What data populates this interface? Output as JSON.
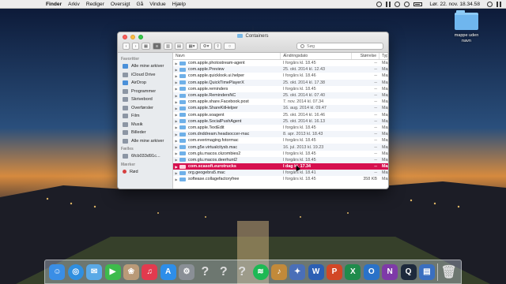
{
  "menubar": {
    "apple": "",
    "items": [
      "Finder",
      "Arkiv",
      "Rediger",
      "Oversigt",
      "Gå",
      "Vindue",
      "Hjælp"
    ],
    "clock": "Lør. 22. nov. 18.34.58"
  },
  "desktop_folder": {
    "label_line1": "mappe uden",
    "label_line2": "navn",
    "icon": "folder-icon"
  },
  "window": {
    "title": "Containers",
    "search_placeholder": "Søg",
    "columns": {
      "name": "Navn",
      "date": "Ændringsdato",
      "size": "Størrelse",
      "type": "Type"
    },
    "sidebar": {
      "favorites_header": "Favoritter",
      "favorites": [
        "Alle mine arkiver",
        "iCloud Drive",
        "AirDrop",
        "Programmer",
        "Skrivebord",
        "Overførsler",
        "Film",
        "Musik",
        "Billeder",
        "Alle mine arkiver"
      ],
      "devices_header": "Fælles",
      "devices": [
        "6fcb033d91c..."
      ],
      "tags_header": "Mærker",
      "tags": [
        "Rød"
      ]
    },
    "rows": [
      {
        "name": "com.apple.photostream-agent",
        "date": "I forgårs kl. 18.45",
        "size": "--",
        "type": "Mappe"
      },
      {
        "name": "com.apple.Preview",
        "date": "25. okt. 2014 kl. 12.43",
        "size": "--",
        "type": "Mappe"
      },
      {
        "name": "com.apple.quicklook.ui.helper",
        "date": "I forgårs kl. 18.46",
        "size": "--",
        "type": "Mappe"
      },
      {
        "name": "com.apple.QuickTimePlayerX",
        "date": "25. okt. 2014 kl. 17.38",
        "size": "--",
        "type": "Mappe"
      },
      {
        "name": "com.apple.reminders",
        "date": "I forgårs kl. 18.45",
        "size": "--",
        "type": "Mappe"
      },
      {
        "name": "com.apple.RemindersNC",
        "date": "25. okt. 2014 kl. 07.40",
        "size": "--",
        "type": "Mappe"
      },
      {
        "name": "com.apple.share.Facebook.post",
        "date": "7. nov. 2014 kl. 07.34",
        "size": "--",
        "type": "Mappe"
      },
      {
        "name": "com.apple.ShareKitHelper",
        "date": "16. aug. 2014 kl. 09.47",
        "size": "--",
        "type": "Mappe"
      },
      {
        "name": "com.apple.soagent",
        "date": "25. okt. 2014 kl. 16.46",
        "size": "--",
        "type": "Mappe"
      },
      {
        "name": "com.apple.SocialPushAgent",
        "date": "25. okt. 2014 kl. 16.13",
        "size": "--",
        "type": "Mappe"
      },
      {
        "name": "com.apple.TextEdit",
        "date": "I forgårs kl. 18.45",
        "size": "--",
        "type": "Mappe"
      },
      {
        "name": "com.dnddream.headsoccer-mac",
        "date": "8. apr. 2013 kl. 18.43",
        "size": "--",
        "type": "Mappe"
      },
      {
        "name": "com.everimaging.fotormac",
        "date": "I forgårs kl. 18.45",
        "size": "--",
        "type": "Mappe"
      },
      {
        "name": "com.g5e.virtualcitysb.mac",
        "date": "16. jul. 2013 kl. 19.23",
        "size": "--",
        "type": "Mappe"
      },
      {
        "name": "com.glu.macos.ckzombies2",
        "date": "I forgårs kl. 18.45",
        "size": "--",
        "type": "Mappe"
      },
      {
        "name": "com.glu.macos.deerhunt2",
        "date": "I forgårs kl. 18.45",
        "size": "--",
        "type": "Mappe"
      },
      {
        "name": "com.scasoft.eurotrucks",
        "date": "I dag kl. 17.34",
        "size": "--",
        "type": "Mappe",
        "selected": true
      },
      {
        "name": "org.geogebra5.mac",
        "date": "I forgårs kl. 18.41",
        "size": "--",
        "type": "Mappe"
      },
      {
        "name": "softease.collagefactoryfree",
        "date": "I forgårs kl. 18.45",
        "size": "358 KB",
        "type": "Mappe"
      }
    ]
  },
  "dock": {
    "apps": [
      {
        "name": "finder-icon",
        "glyph": "☺",
        "color": "#3a8ee6"
      },
      {
        "name": "safari-icon",
        "glyph": "◎",
        "color": "#2f8fe0"
      },
      {
        "name": "mail-icon",
        "glyph": "✉",
        "color": "#5aa9e6"
      },
      {
        "name": "facetime-icon",
        "glyph": "▶",
        "color": "#3dbb4c"
      },
      {
        "name": "photos-icon",
        "glyph": "❀",
        "color": "#b99a78"
      },
      {
        "name": "music-icon",
        "glyph": "♫",
        "color": "#e23a4e"
      },
      {
        "name": "app-store-icon",
        "glyph": "A",
        "color": "#2d8ee9"
      },
      {
        "name": "system-preferences-icon",
        "glyph": "⚙",
        "color": "#8a8f96"
      },
      {
        "name": "unknown-app-icon-1",
        "glyph": "?",
        "color": "transparent"
      },
      {
        "name": "unknown-app-icon-2",
        "glyph": "?",
        "color": "transparent"
      },
      {
        "name": "unknown-app-icon-3",
        "glyph": "?",
        "color": "transparent"
      },
      {
        "name": "spotify-icon",
        "glyph": "≋",
        "color": "#1db954"
      },
      {
        "name": "guitar-app-icon",
        "glyph": "♪",
        "color": "#c28a3a"
      },
      {
        "name": "game-app-icon",
        "glyph": "✦",
        "color": "#4a6fb8"
      },
      {
        "name": "word-icon",
        "glyph": "W",
        "color": "#2b5fb4"
      },
      {
        "name": "powerpoint-icon",
        "glyph": "P",
        "color": "#d24726"
      },
      {
        "name": "excel-icon",
        "glyph": "X",
        "color": "#1f8b4c"
      },
      {
        "name": "outlook-icon",
        "glyph": "O",
        "color": "#2a72c8"
      },
      {
        "name": "onenote-icon",
        "glyph": "N",
        "color": "#7e3aa8"
      },
      {
        "name": "quicktime-icon",
        "glyph": "Q",
        "color": "#1e2a3c"
      },
      {
        "name": "screen-app-icon",
        "glyph": "▤",
        "color": "#3a6fc0"
      },
      {
        "name": "trash-icon",
        "glyph": "🗑",
        "color": "transparent"
      }
    ]
  },
  "colors": {
    "selection": "#d6104f",
    "sidebar_bg": "#e8ebee",
    "folder_blue": "#6fb0e8"
  }
}
